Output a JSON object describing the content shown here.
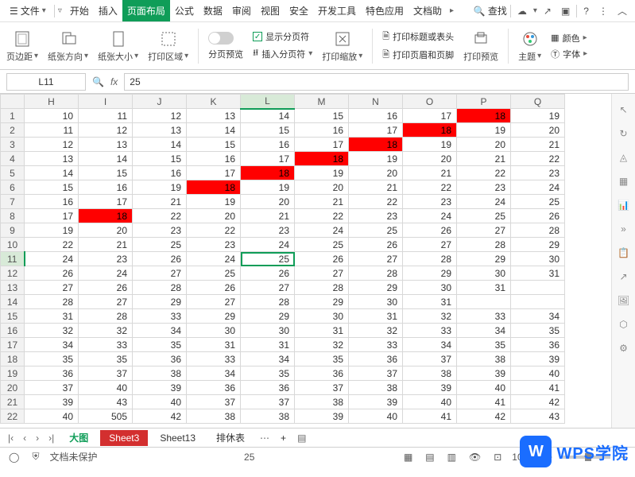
{
  "menubar": {
    "file": "文件",
    "tabs": [
      "开始",
      "插入",
      "页面布局",
      "公式",
      "数据",
      "审阅",
      "视图",
      "安全",
      "开发工具",
      "特色应用",
      "文档助"
    ],
    "active_tab": 2,
    "search": "查找"
  },
  "ribbon": {
    "margin": "页边距",
    "orientation": "纸张方向",
    "size": "纸张大小",
    "print_area": "打印区域",
    "page_break_preview": "分页预览",
    "show_page_break": "显示分页符",
    "insert_page_break": "插入分页符",
    "scale": "打印缩放",
    "print_titles": "打印标题或表头",
    "header_footer": "打印页眉和页脚",
    "print_preview": "打印预览",
    "theme": "主题",
    "color": "颜色",
    "font": "字体"
  },
  "formula": {
    "cell_ref": "L11",
    "value": "25"
  },
  "sheet": {
    "columns": [
      "H",
      "I",
      "J",
      "K",
      "L",
      "M",
      "N",
      "O",
      "P",
      "Q"
    ],
    "active_col": "L",
    "active_row": 11,
    "rows": [
      {
        "r": 1,
        "c": [
          10,
          11,
          12,
          13,
          14,
          15,
          16,
          17,
          18,
          19
        ]
      },
      {
        "r": 2,
        "c": [
          11,
          12,
          13,
          14,
          15,
          16,
          17,
          18,
          19,
          20
        ]
      },
      {
        "r": 3,
        "c": [
          12,
          13,
          14,
          15,
          16,
          17,
          18,
          19,
          20,
          21
        ]
      },
      {
        "r": 4,
        "c": [
          13,
          14,
          15,
          16,
          17,
          18,
          19,
          20,
          21,
          22
        ]
      },
      {
        "r": 5,
        "c": [
          14,
          15,
          16,
          17,
          18,
          19,
          20,
          21,
          22,
          23
        ]
      },
      {
        "r": 6,
        "c": [
          15,
          16,
          19,
          18,
          19,
          20,
          21,
          22,
          23,
          24
        ]
      },
      {
        "r": 7,
        "c": [
          16,
          17,
          21,
          19,
          20,
          21,
          22,
          23,
          24,
          25
        ]
      },
      {
        "r": 8,
        "c": [
          17,
          18,
          22,
          20,
          21,
          22,
          23,
          24,
          25,
          26
        ]
      },
      {
        "r": 9,
        "c": [
          19,
          20,
          23,
          22,
          23,
          24,
          25,
          26,
          27,
          28
        ]
      },
      {
        "r": 10,
        "c": [
          22,
          21,
          25,
          23,
          24,
          25,
          26,
          27,
          28,
          29
        ]
      },
      {
        "r": 11,
        "c": [
          24,
          23,
          26,
          24,
          25,
          26,
          27,
          28,
          29,
          30
        ]
      },
      {
        "r": 12,
        "c": [
          26,
          24,
          27,
          25,
          26,
          27,
          28,
          29,
          30,
          31
        ]
      },
      {
        "r": 13,
        "c": [
          27,
          26,
          28,
          26,
          27,
          28,
          29,
          30,
          31,
          ""
        ]
      },
      {
        "r": 14,
        "c": [
          28,
          27,
          29,
          27,
          28,
          29,
          30,
          31,
          "",
          ""
        ]
      },
      {
        "r": 15,
        "c": [
          31,
          28,
          33,
          29,
          29,
          30,
          31,
          32,
          33,
          34
        ]
      },
      {
        "r": 16,
        "c": [
          32,
          32,
          34,
          30,
          30,
          31,
          32,
          33,
          34,
          35
        ]
      },
      {
        "r": 17,
        "c": [
          34,
          33,
          35,
          31,
          31,
          32,
          33,
          34,
          35,
          36
        ]
      },
      {
        "r": 18,
        "c": [
          35,
          35,
          36,
          33,
          34,
          35,
          36,
          37,
          38,
          39
        ]
      },
      {
        "r": 19,
        "c": [
          36,
          37,
          38,
          34,
          35,
          36,
          37,
          38,
          39,
          40
        ]
      },
      {
        "r": 20,
        "c": [
          37,
          40,
          39,
          36,
          36,
          37,
          38,
          39,
          40,
          41
        ]
      },
      {
        "r": 21,
        "c": [
          39,
          43,
          40,
          37,
          37,
          38,
          39,
          40,
          41,
          42
        ]
      },
      {
        "r": 22,
        "c": [
          40,
          505,
          42,
          38,
          38,
          39,
          40,
          41,
          42,
          43
        ]
      }
    ],
    "red_cells": [
      [
        1,
        "P"
      ],
      [
        2,
        "O"
      ],
      [
        3,
        "N"
      ],
      [
        4,
        "M"
      ],
      [
        5,
        "L"
      ],
      [
        6,
        "K"
      ],
      [
        8,
        "I"
      ]
    ]
  },
  "sheet_tabs": {
    "tabs": [
      "大图",
      "Sheet3",
      "Sheet13",
      "排休表"
    ],
    "active": 1
  },
  "statusbar": {
    "protect": "文档未保护",
    "value": "25",
    "zoom": "100%"
  },
  "logo": {
    "initial": "W",
    "text": "WPS学院"
  }
}
